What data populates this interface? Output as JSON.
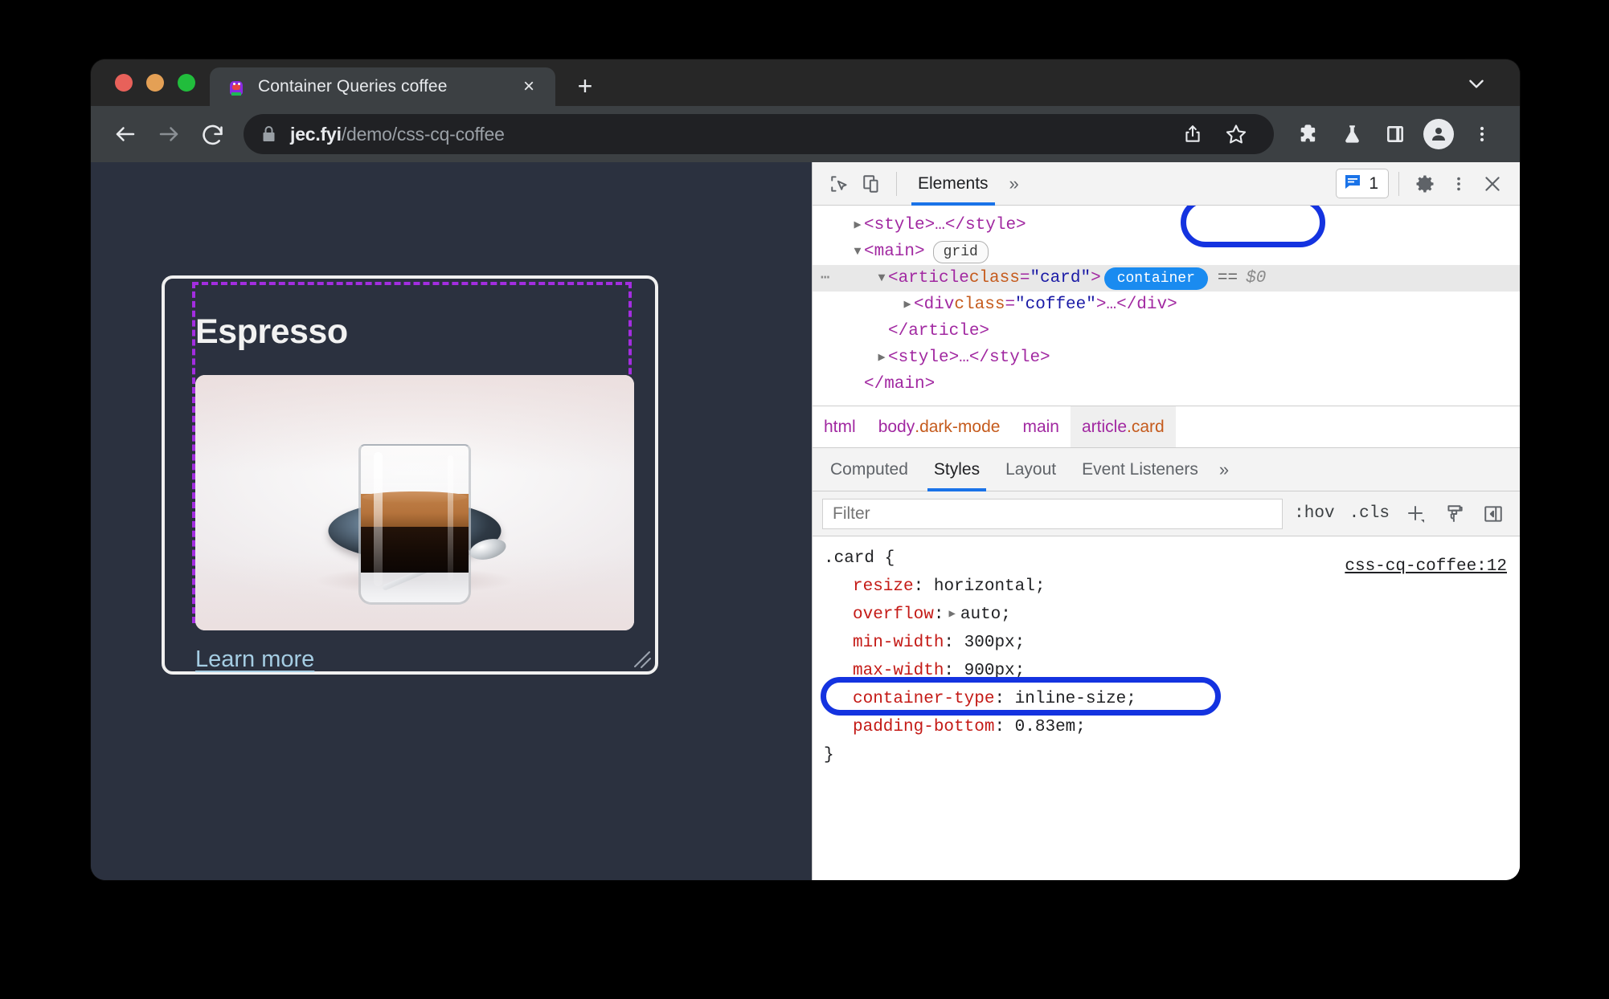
{
  "window": {
    "traffic_lights": [
      "close",
      "minimize",
      "maximize"
    ],
    "colors": {
      "red": "#E8615A",
      "yellow": "#E4A055",
      "green": "#21BD3C"
    }
  },
  "tabstrip": {
    "tab_title": "Container Queries coffee",
    "tab_close_glyph": "×",
    "new_tab_glyph": "+",
    "tab_list_icon": "chevron-down-icon"
  },
  "toolbar": {
    "back_icon": "back-arrow-icon",
    "forward_icon": "forward-arrow-icon",
    "reload_icon": "reload-icon",
    "lock_icon": "lock-icon",
    "url_host": "jec.fyi",
    "url_path": "/demo/css-cq-coffee",
    "url_full": "jec.fyi/demo/css-cq-coffee",
    "actions": [
      "share-icon",
      "bookmark-star-icon",
      "extensions-puzzle-icon",
      "labs-flask-icon",
      "side-panel-icon",
      "profile-avatar",
      "browser-menu-icon"
    ]
  },
  "page": {
    "background": "#2B313F",
    "card": {
      "title": "Espresso",
      "link_label": "Learn more",
      "image_alt": "glass of espresso with crema on a metal saucer with spoon",
      "border_color": "#F0F0F0",
      "container_overlay_color": "#A32DE0",
      "resize_handle": "resize-handle"
    }
  },
  "devtools": {
    "toolbar": {
      "inspect_icon": "inspect-element-icon",
      "device_icon": "device-toolbar-icon",
      "tabs": [
        {
          "label": "Elements",
          "active": true
        }
      ],
      "more_tabs_glyph": "»",
      "issues_icon": "issues-message-icon",
      "issues_count": "1",
      "settings_icon": "gear-icon",
      "more_icon": "devtools-more-icon",
      "close_icon": "close-icon"
    },
    "dom_tree": {
      "rows": [
        {
          "indent": 1,
          "triangle": "collapsed",
          "parts": [
            {
              "t": "tag",
              "v": "<style>"
            },
            {
              "t": "dots",
              "v": "…"
            },
            {
              "t": "tag",
              "v": "</style>"
            }
          ]
        },
        {
          "indent": 1,
          "triangle": "expanded",
          "parts": [
            {
              "t": "tag",
              "v": "<main>"
            }
          ],
          "badge": "grid",
          "badge_label": "grid"
        },
        {
          "indent": 2,
          "triangle": "expanded",
          "selected": true,
          "dots_menu": true,
          "parts": [
            {
              "t": "tag",
              "v": "<article "
            },
            {
              "t": "attrn",
              "v": "class"
            },
            {
              "t": "punc",
              "v": "="
            },
            {
              "t": "attrv",
              "v": "\"card\""
            },
            {
              "t": "tag",
              "v": ">"
            }
          ],
          "badge": "container",
          "badge_label": "container",
          "suffix_eq": "==",
          "suffix_dollar": "$0",
          "annotated": true
        },
        {
          "indent": 3,
          "triangle": "collapsed",
          "parts": [
            {
              "t": "tag",
              "v": "<div "
            },
            {
              "t": "attrn",
              "v": "class"
            },
            {
              "t": "punc",
              "v": "="
            },
            {
              "t": "attrv",
              "v": "\"coffee\""
            },
            {
              "t": "tag",
              "v": ">"
            },
            {
              "t": "dots",
              "v": "…"
            },
            {
              "t": "tag",
              "v": "</div>"
            }
          ]
        },
        {
          "indent": 2,
          "triangle": "none",
          "parts": [
            {
              "t": "tag",
              "v": "</article>"
            }
          ]
        },
        {
          "indent": 2,
          "triangle": "collapsed",
          "parts": [
            {
              "t": "tag",
              "v": "<style>"
            },
            {
              "t": "dots",
              "v": "…"
            },
            {
              "t": "tag",
              "v": "</style>"
            }
          ]
        },
        {
          "indent": 1,
          "triangle": "none",
          "parts": [
            {
              "t": "tag",
              "v": "</main>"
            }
          ]
        }
      ]
    },
    "breadcrumb": [
      {
        "label": "html",
        "selected": false
      },
      {
        "label": "body",
        "cls": ".dark-mode",
        "selected": false
      },
      {
        "label": "main",
        "selected": false
      },
      {
        "label": "article",
        "cls": ".card",
        "selected": true
      }
    ],
    "sidebar_tabs": [
      {
        "label": "Computed",
        "active": false
      },
      {
        "label": "Styles",
        "active": true
      },
      {
        "label": "Layout",
        "active": false
      },
      {
        "label": "Event Listeners",
        "active": false
      }
    ],
    "sidebar_more_glyph": "»",
    "filter_bar": {
      "placeholder": "Filter",
      "value": "",
      "hov_label": ":hov",
      "cls_label": ".cls",
      "new_rule_icon": "plus-new-style-rule-icon",
      "element_styles_icon": "paintbrush-icon",
      "toggle_sidebar_icon": "toggle-sidebar-icon"
    },
    "styles": {
      "source_link": "css-cq-coffee:12",
      "selector": ".card {",
      "closing": "}",
      "declarations": [
        {
          "property": "resize",
          "value": "horizontal;",
          "expandable": false,
          "highlighted": false
        },
        {
          "property": "overflow",
          "value": "auto;",
          "expandable": true,
          "highlighted": false
        },
        {
          "property": "min-width",
          "value": "300px;",
          "expandable": false,
          "highlighted": false
        },
        {
          "property": "max-width",
          "value": "900px;",
          "expandable": false,
          "highlighted": false
        },
        {
          "property": "container-type",
          "value": "inline-size;",
          "expandable": false,
          "highlighted": true
        },
        {
          "property": "padding-bottom",
          "value": "0.83em;",
          "expandable": false,
          "highlighted": false
        }
      ]
    }
  },
  "annotations": {
    "ring_color": "#1433E0",
    "targets": [
      "container-badge",
      "container-type-declaration"
    ]
  }
}
